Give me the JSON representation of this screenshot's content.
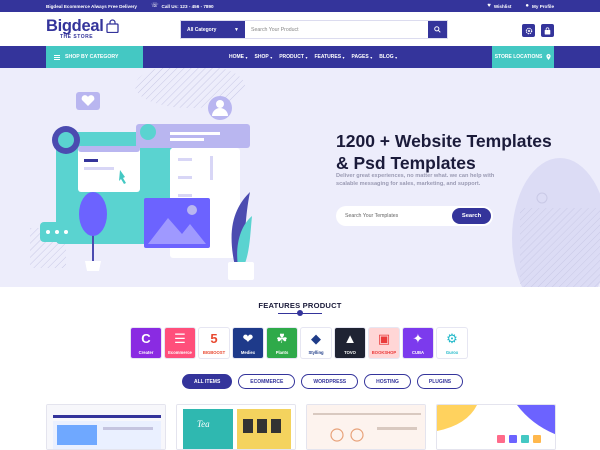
{
  "topbar": {
    "promo": "Bigdeal Ecommerce Always Free Delivery",
    "phone": "Call Us: 123 - 456 - 7890",
    "wishlist": "Wishlist",
    "profile": "My Profile"
  },
  "header": {
    "logo_main": "Bigdeal",
    "logo_sub": "THE STORE",
    "category_select": "All Category",
    "search_placeholder": "Search Your Product"
  },
  "nav": {
    "shop_by_category": "SHOP BY CATEGORY",
    "menu": [
      "HOME",
      "SHOP",
      "PRODUCT",
      "FEATURES",
      "PAGES",
      "BLOG"
    ],
    "store_locations": "STORE LOCATIONS"
  },
  "hero": {
    "title_line1": "1200 + Website Templates",
    "title_line2": "& Psd Templates",
    "description": "Deliver great experiences, no matter what. we can help with scalable messaging for sales, marketing, and support.",
    "search_placeholder": "Search Your Templates",
    "search_button": "Search"
  },
  "features": {
    "title": "FEATURES PRODUCT",
    "products": [
      {
        "name": "Creater",
        "glyph": "C",
        "bg": "#8a2be2",
        "fg": "#ffffff"
      },
      {
        "name": "Ecommerce",
        "glyph": "☰",
        "bg": "#ff4f7b",
        "fg": "#ffffff"
      },
      {
        "name": "BIGBOOST",
        "glyph": "5",
        "bg": "#ffffff",
        "fg": "#e8482f"
      },
      {
        "name": "Mediex",
        "glyph": "❤",
        "bg": "#1e3a8a",
        "fg": "#ffffff"
      },
      {
        "name": "Plants",
        "glyph": "☘",
        "bg": "#2faa4a",
        "fg": "#ffffff"
      },
      {
        "name": "Stylling",
        "glyph": "◆",
        "bg": "#ffffff",
        "fg": "#1f3c88"
      },
      {
        "name": "TOVO",
        "glyph": "▲",
        "bg": "#1f2333",
        "fg": "#ffffff"
      },
      {
        "name": "BOOKSHOP",
        "glyph": "▣",
        "bg": "#ffd6d6",
        "fg": "#ea3b3b"
      },
      {
        "name": "CUBA",
        "glyph": "✦",
        "bg": "#7c3aed",
        "fg": "#ffffff"
      },
      {
        "name": "Gurox",
        "glyph": "⚙",
        "bg": "#ffffff",
        "fg": "#1fb8c9"
      }
    ],
    "filters": [
      {
        "label": "ALL ITEMS",
        "active": true
      },
      {
        "label": "ECOMMERCE",
        "active": false
      },
      {
        "label": "WORDPRESS",
        "active": false
      },
      {
        "label": "HOSTING",
        "active": false
      },
      {
        "label": "PLUGINS",
        "active": false
      }
    ]
  },
  "colors": {
    "primary": "#34349b",
    "accent": "#44c8c3",
    "hero_bg": "#ededfb"
  }
}
